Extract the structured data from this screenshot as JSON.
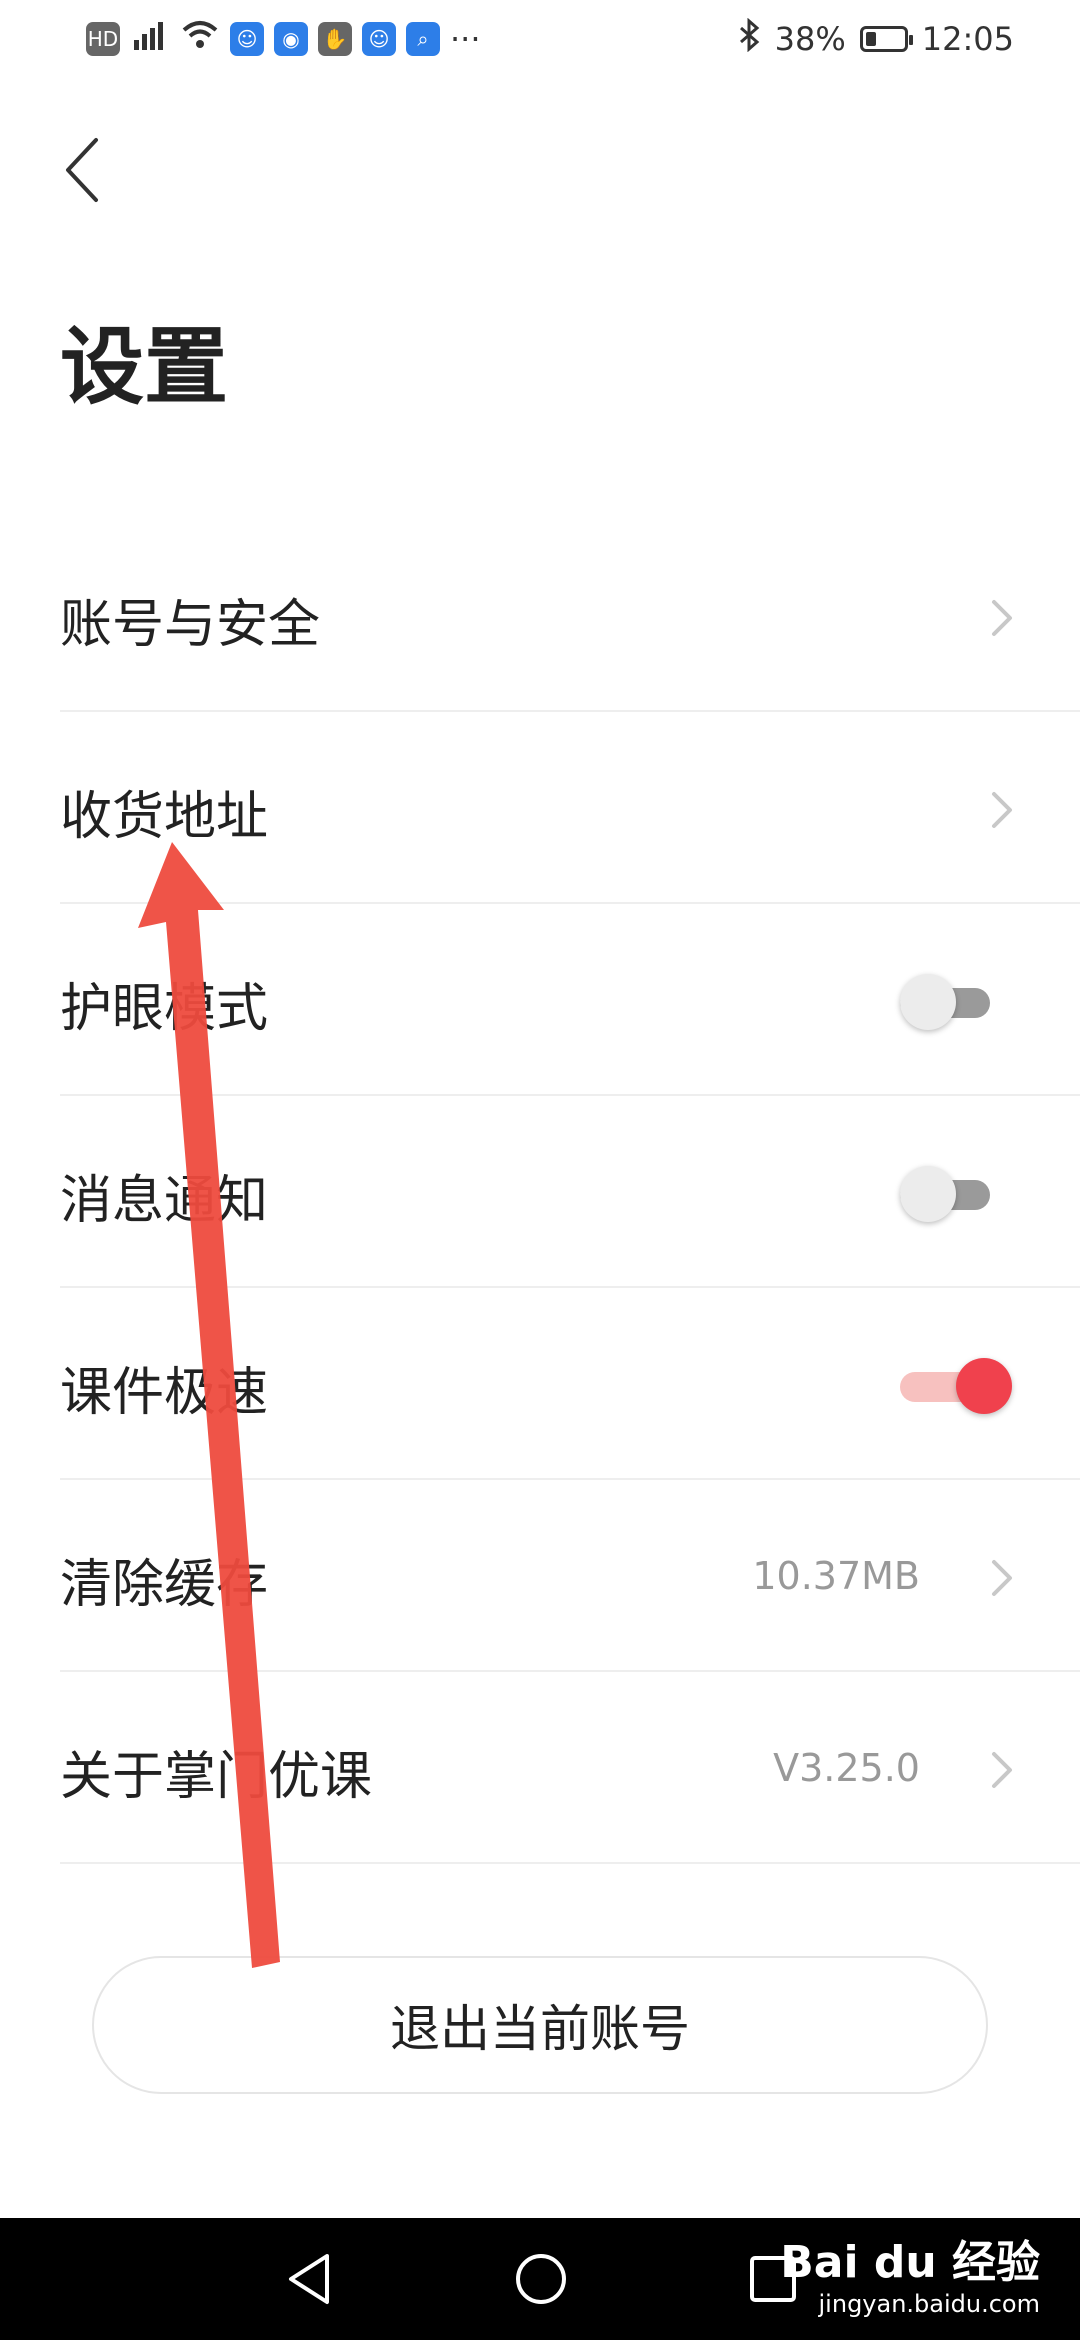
{
  "status_bar": {
    "left_icons": [
      "hd-icon",
      "4g-signal-icon",
      "wifi-icon",
      "app-icon-1",
      "app-icon-2",
      "app-icon-3",
      "app-icon-4",
      "search-app-icon"
    ],
    "overflow": "···",
    "battery": "38%",
    "battery_level": 0.38,
    "time": "12:05"
  },
  "page": {
    "title": "设置"
  },
  "settings": [
    {
      "label": "账号与安全",
      "type": "link"
    },
    {
      "label": "收货地址",
      "type": "link"
    },
    {
      "label": "护眼模式",
      "type": "toggle",
      "on": false
    },
    {
      "label": "消息通知",
      "type": "toggle",
      "on": false
    },
    {
      "label": "课件极速",
      "type": "toggle",
      "on": true
    },
    {
      "label": "清除缓存",
      "type": "link",
      "value": "10.37MB"
    },
    {
      "label": "关于掌门优课",
      "type": "link",
      "value": "V3.25.0"
    }
  ],
  "logout": {
    "label": "退出当前账号"
  },
  "watermark": {
    "brand": "Bai du 经验",
    "url": "jingyan.baidu.com"
  },
  "colors": {
    "toggle_on": "#f0414d",
    "annotation_arrow": "#ee4b3e"
  }
}
